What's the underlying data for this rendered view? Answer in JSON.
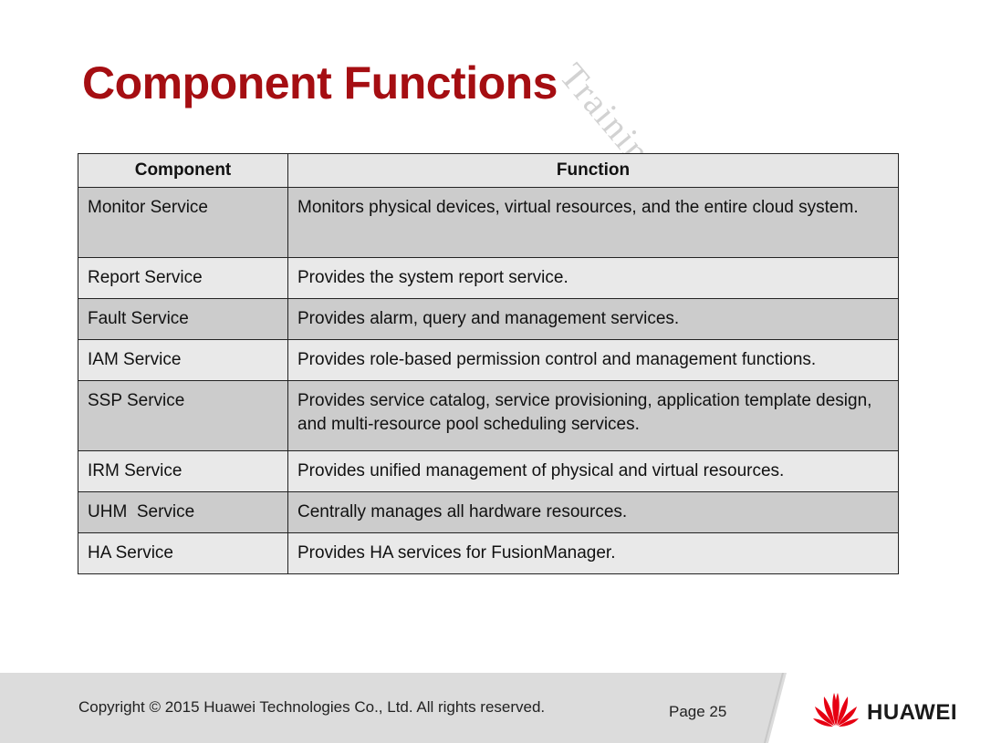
{
  "slide": {
    "title": "Component Functions",
    "watermark": "Training & Education Dept"
  },
  "table": {
    "headers": [
      "Component",
      "Function"
    ],
    "rows": [
      {
        "component": "Monitor Service",
        "function": "Monitors physical devices, virtual resources, and the entire cloud system."
      },
      {
        "component": "Report Service",
        "function": "Provides the system report service."
      },
      {
        "component": "Fault Service",
        "function": "Provides alarm, query and management services."
      },
      {
        "component": "IAM Service",
        "function": "Provides role-based permission control and management functions."
      },
      {
        "component": "SSP Service",
        "function": "Provides service catalog, service provisioning, application template design, and multi-resource pool scheduling services."
      },
      {
        "component": "IRM Service",
        "function": "Provides unified management of physical and virtual resources."
      },
      {
        "component": "UHM  Service",
        "function": "Centrally manages all hardware resources."
      },
      {
        "component": "HA Service",
        "function": "Provides HA services for FusionManager."
      }
    ]
  },
  "footer": {
    "copyright": "Copyright © 2015 Huawei Technologies Co., Ltd. All rights reserved.",
    "page": "Page 25",
    "brand": "HUAWEI",
    "logo_icon": "huawei-petal-logo",
    "logo_color": "#e60012"
  }
}
